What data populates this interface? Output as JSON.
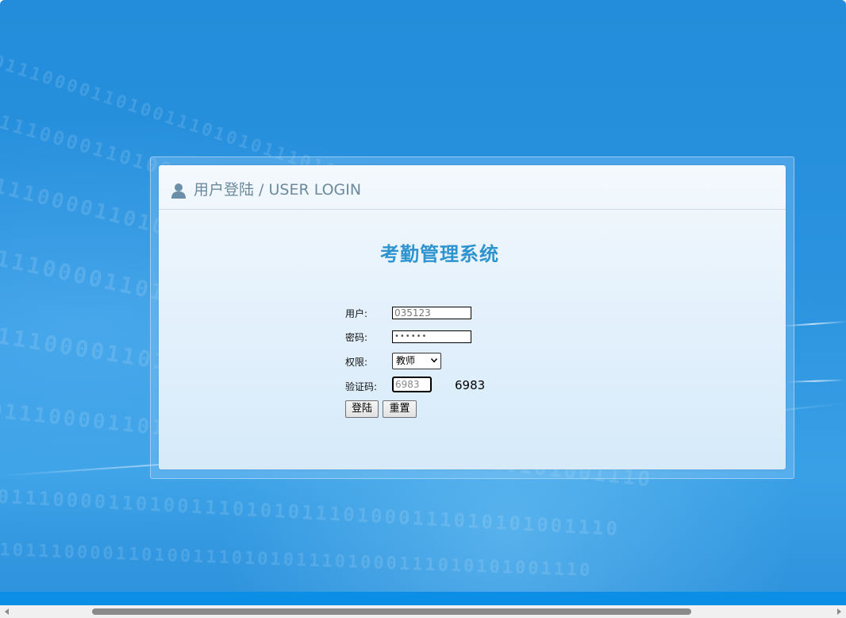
{
  "panel": {
    "title": "用户登陆 / USER LOGIN"
  },
  "system": {
    "title": "考勤管理系统"
  },
  "form": {
    "username_label": "用户:",
    "username_value": "035123",
    "password_label": "密码:",
    "password_value": "••••••",
    "role_label": "权限:",
    "role_selected": "教师",
    "captcha_label": "验证码:",
    "captcha_input_value": "6983",
    "captcha_code": "6983",
    "login_button": "登陆",
    "reset_button": "重置"
  },
  "background": {
    "digits": "1011100001101001110101011101000111010101001110"
  },
  "colors": {
    "background": "#2a8fdd",
    "title": "#2e94cf",
    "panel_header_text": "#6c8a9b",
    "bottom_bar": "#0a8ee6"
  }
}
